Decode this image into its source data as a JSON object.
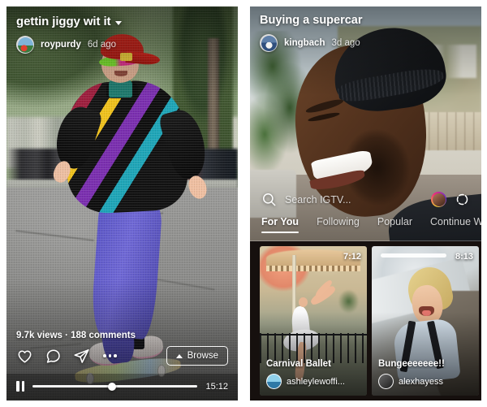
{
  "left_panel": {
    "video_title": "gettin jiggy wit it",
    "dropdown_icon": "chevron-down-icon",
    "username": "roypurdy",
    "time_ago": "6d ago",
    "avatar_icon": "user-avatar",
    "stats": "9.7k views · 188 comments",
    "actions": [
      {
        "name": "like-button",
        "icon": "heart-icon"
      },
      {
        "name": "comment-button",
        "icon": "comment-icon"
      },
      {
        "name": "share-button",
        "icon": "paper-plane-icon"
      },
      {
        "name": "more-options-button",
        "icon": "ellipsis-icon"
      }
    ],
    "browse_label": "Browse",
    "browse_icon": "chevron-up-icon",
    "player": {
      "pause_icon": "pause-icon",
      "progress_percent": 48,
      "duration": "15:12"
    }
  },
  "right_panel": {
    "video_title": "Buying a supercar",
    "username": "kingbach",
    "time_ago": "3d ago",
    "avatar_icon": "user-avatar",
    "search": {
      "icon": "search-icon",
      "placeholder": "Search IGTV...",
      "value": "",
      "profile_icon": "profile-avatar-icon",
      "live_icon": "igtv-live-icon"
    },
    "tabs": [
      {
        "label": "For You",
        "active": true
      },
      {
        "label": "Following",
        "active": false
      },
      {
        "label": "Popular",
        "active": false
      },
      {
        "label": "Continue W",
        "active": false
      }
    ],
    "cards": [
      {
        "title": "Carnival Ballet",
        "username": "ashleylewoffi...",
        "duration": "7:12",
        "avatar_icon": "user-avatar"
      },
      {
        "title": "Bungeeeeeee!!",
        "username": "alexhayess",
        "duration": "8:13",
        "avatar_icon": "user-avatar"
      },
      {
        "title": "",
        "username": "",
        "duration": "",
        "avatar_icon": ""
      }
    ]
  },
  "colors": {
    "accent_white": "#ffffff",
    "panel_background": "#000000",
    "page_background": "#ffffff",
    "rail_background": "#16100e"
  }
}
